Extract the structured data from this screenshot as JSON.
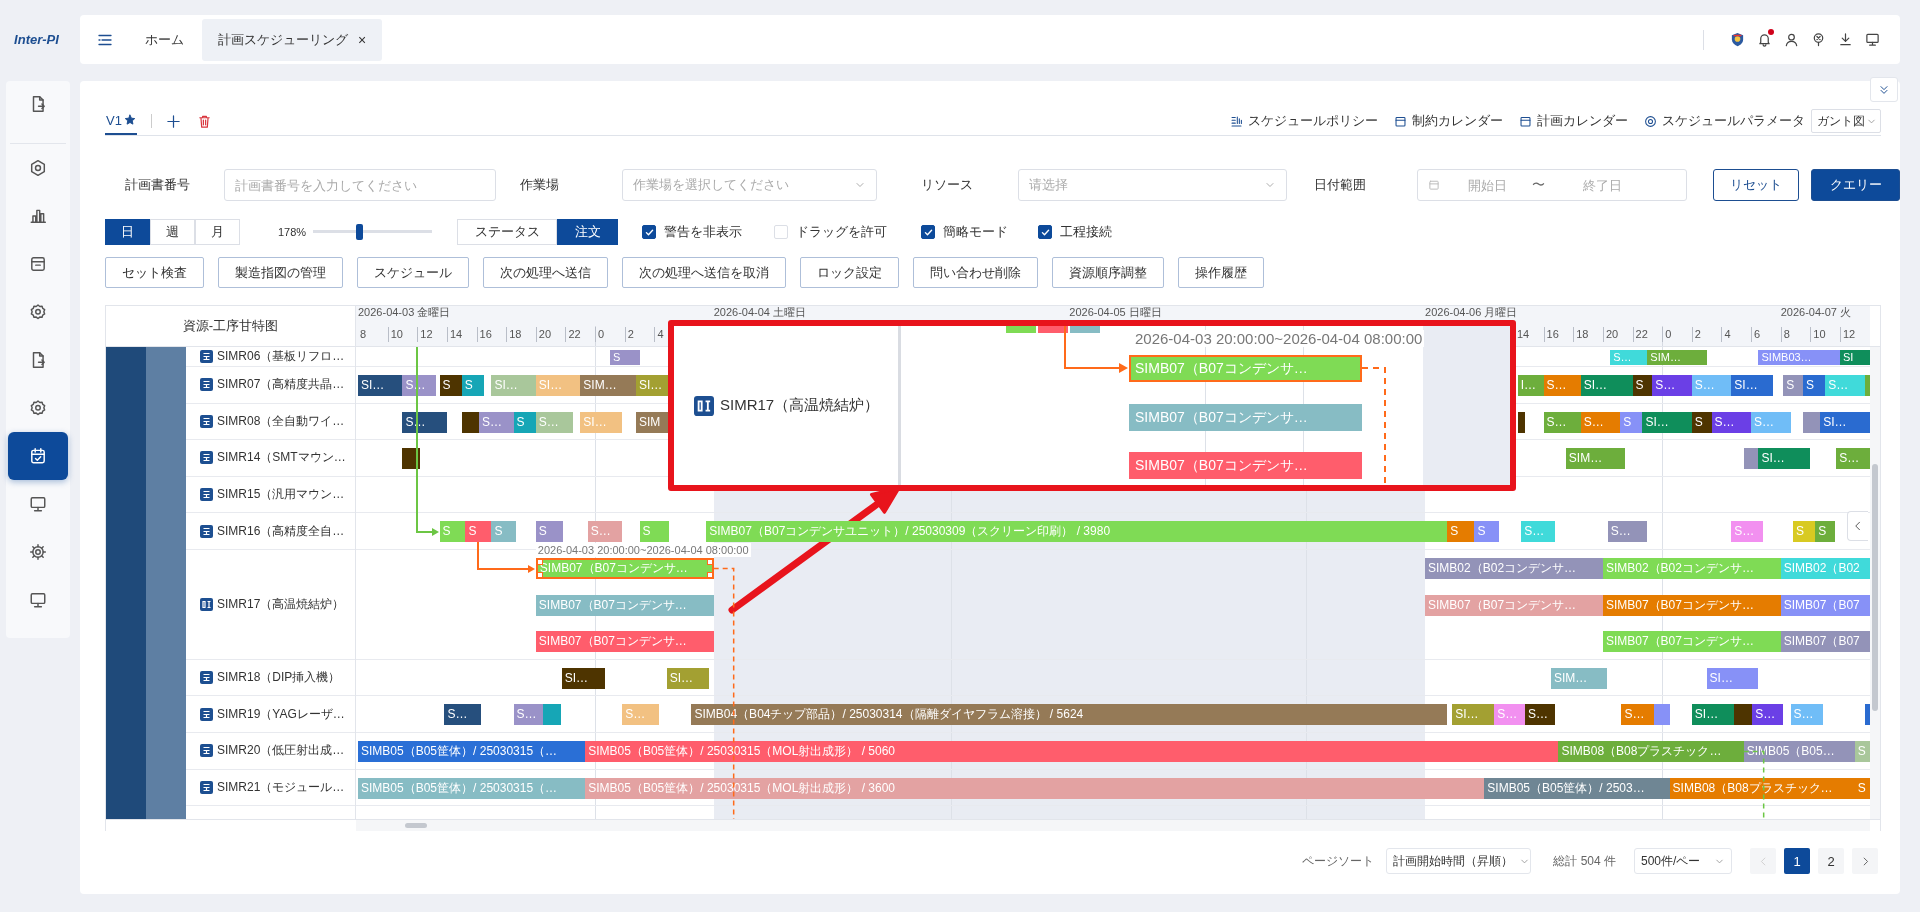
{
  "app": {
    "logo": "Inter-PI"
  },
  "sidebar": {
    "items": [
      {
        "selected": false
      },
      {
        "selected": false
      },
      {
        "selected": false
      },
      {
        "selected": false
      },
      {
        "selected": false
      },
      {
        "selected": false
      },
      {
        "selected": false
      },
      {
        "selected": true
      },
      {
        "selected": false
      },
      {
        "selected": false
      },
      {
        "selected": false
      }
    ]
  },
  "topbar": {
    "tabs": [
      {
        "label": "ホーム",
        "selected": false,
        "closable": false
      },
      {
        "label": "計画スケジューリング",
        "selected": true,
        "closable": true
      }
    ],
    "close_glyph": "×",
    "icons": [
      {
        "badge": false
      },
      {
        "badge": true
      },
      {
        "badge": false
      },
      {
        "badge": false
      },
      {
        "badge": false
      },
      {
        "badge": false
      }
    ]
  },
  "versions": {
    "tabs": [
      {
        "label": "V1",
        "selected": true,
        "starred": true
      }
    ],
    "links": [
      "スケジュールポリシー",
      "制約カレンダー",
      "計画カレンダー",
      "スケジュールパラメータ"
    ],
    "view_select": "ガント図"
  },
  "filters": {
    "fields": [
      {
        "kind": "text",
        "label": "計画書番号",
        "placeholder": "計画書番号を入力してください"
      },
      {
        "kind": "select",
        "label": "作業場",
        "placeholder": "作業場を選択してください"
      },
      {
        "kind": "select",
        "label": "リソース",
        "placeholder": "请选择"
      },
      {
        "kind": "daterange",
        "label": "日付範囲",
        "placeholder": "開始日",
        "placeholder_end": "終了日",
        "separator": "〜"
      }
    ],
    "buttons": [
      {
        "kind": "secondary",
        "label": "リセット"
      },
      {
        "kind": "primary",
        "label": "クエリー"
      }
    ]
  },
  "toolbar": {
    "scale": [
      {
        "label": "日",
        "selected": true
      },
      {
        "label": "週",
        "selected": false
      },
      {
        "label": "月",
        "selected": false
      }
    ],
    "zoom": {
      "reading": "178%",
      "level": 0.39
    },
    "mode": [
      {
        "label": "ステータス",
        "selected": false
      },
      {
        "label": "注文",
        "selected": true
      }
    ],
    "options": [
      {
        "label": "警告を非表示",
        "checked": true
      },
      {
        "label": "ドラッグを許可",
        "checked": false
      },
      {
        "label": "簡略モード",
        "checked": true
      },
      {
        "label": "工程接続",
        "checked": true
      }
    ]
  },
  "actions": [
    "セット検査",
    "製造指図の管理",
    "スケジュール",
    "次の処理へ送信",
    "次の処理へ送信を取消",
    "ロック設定",
    "問い合わせ削除",
    "資源順序調整",
    "操作履歴"
  ],
  "gantt": {
    "header": "資源-工序甘特图",
    "dates": [
      "2026-04-03 金曜日",
      "2026-04-04 土曜日",
      "2026-04-05 日曜日",
      "2026-04-06 月曜日",
      "2026-04-07 火"
    ],
    "hours": [
      "8",
      "10",
      "12",
      "14",
      "16",
      "18",
      "20",
      "22",
      "0",
      "2",
      "4",
      "14",
      "16",
      "18",
      "20",
      "22",
      "0",
      "2",
      "4",
      "6",
      "8",
      "10",
      "12"
    ],
    "rows": [
      {
        "name": "SIMR06（基板リフロ…",
        "bars": [
          {
            "label": "S",
            "color": "#9a92c8",
            "selected": false
          },
          {
            "label": "S…",
            "color": "#40dada",
            "selected": false
          },
          {
            "label": "SIM…",
            "color": "#6dae3c",
            "selected": false
          },
          {
            "label": "SIMB03…",
            "color": "#8791f7",
            "selected": false
          },
          {
            "label": "SI",
            "color": "#0f8e5b",
            "selected": false
          }
        ]
      },
      {
        "name": "SIMR07（高精度共晶…",
        "bars": [
          {
            "label": "SI…",
            "color": "#264f7d",
            "selected": false
          },
          {
            "label": "S…",
            "color": "#9a92c8",
            "selected": false
          },
          {
            "label": "S",
            "color": "#4e3400",
            "selected": false
          },
          {
            "label": "S",
            "color": "#16a6b6",
            "selected": false
          },
          {
            "label": "SI…",
            "color": "#a9c79b",
            "selected": false
          },
          {
            "label": "SI…",
            "color": "#f2c182",
            "selected": false
          },
          {
            "label": "SIM…",
            "color": "#957a57",
            "selected": false
          },
          {
            "label": "SI…",
            "color": "#a3a032",
            "selected": false
          },
          {
            "label": "I…",
            "color": "#6dae3c",
            "selected": false
          },
          {
            "label": "S…",
            "color": "#e57c00",
            "selected": false
          },
          {
            "label": "SI…",
            "color": "#0f8e5b",
            "selected": false
          },
          {
            "label": "S",
            "color": "#4e3400",
            "selected": false
          },
          {
            "label": "S…",
            "color": "#6b3fe6",
            "selected": false
          },
          {
            "label": "S…",
            "color": "#70bdf7",
            "selected": false
          },
          {
            "label": "SI…",
            "color": "#2a6bd0",
            "selected": false
          },
          {
            "label": "S",
            "color": "#9393b8",
            "selected": false
          },
          {
            "label": "S",
            "color": "#2a6bd0",
            "selected": false
          },
          {
            "label": "S…",
            "color": "#40dada",
            "selected": false
          },
          {
            "color": "#6dae3c",
            "selected": false
          }
        ]
      },
      {
        "name": "SIMR08（全自動ワイ…",
        "bars": [
          {
            "label": "S…",
            "color": "#264f7d",
            "selected": false
          },
          {
            "color": "#4e3400",
            "selected": false
          },
          {
            "label": "S…",
            "color": "#9a92c8",
            "selected": false
          },
          {
            "label": "S",
            "color": "#16a6b6",
            "selected": false
          },
          {
            "label": "S…",
            "color": "#a9c79b",
            "selected": false
          },
          {
            "label": "SI…",
            "color": "#f2c182",
            "selected": false
          },
          {
            "label": "SIM",
            "color": "#957a57",
            "selected": false
          },
          {
            "color": "#4e3400",
            "selected": false
          },
          {
            "label": "S…",
            "color": "#6dae3c",
            "selected": false
          },
          {
            "label": "S…",
            "color": "#e57c00",
            "selected": false
          },
          {
            "label": "S",
            "color": "#8791f7",
            "selected": false
          },
          {
            "label": "SI…",
            "color": "#0f8e5b",
            "selected": false
          },
          {
            "label": "S",
            "color": "#4e3400",
            "selected": false
          },
          {
            "label": "S…",
            "color": "#6b3fe6",
            "selected": false
          },
          {
            "label": "S…",
            "color": "#70bdf7",
            "selected": false
          },
          {
            "color": "#9393b8",
            "selected": false
          },
          {
            "label": "SI…",
            "color": "#2a6bd0",
            "selected": false
          }
        ]
      },
      {
        "name": "SIMR14（SMTマウン…",
        "bars": [
          {
            "color": "#4e3400",
            "selected": false
          },
          {
            "label": "SIM…",
            "color": "#6dae3c",
            "selected": false
          },
          {
            "color": "#9393b8",
            "selected": false
          },
          {
            "label": "SI…",
            "color": "#0f8e5b",
            "selected": false
          },
          {
            "label": "S…",
            "color": "#6dae3c",
            "selected": false
          }
        ]
      },
      {
        "name": "SIMR15（汎用マウン…"
      },
      {
        "name": "SIMR16（高精度全自…",
        "bars": [
          {
            "label": "S",
            "color": "#7fdb55",
            "selected": false
          },
          {
            "label": "S",
            "color": "#ff5d6c",
            "selected": false
          },
          {
            "label": "S",
            "color": "#87bcc4",
            "selected": false
          },
          {
            "label": "S",
            "color": "#9a92c8",
            "selected": false
          },
          {
            "label": "S…",
            "color": "#e3a2a2",
            "selected": false
          },
          {
            "label": "S",
            "color": "#7fdb55",
            "selected": false
          },
          {
            "label": "SIMB07（B07コンデンサユニット）/ 25030309（スクリーン印刷） / 3980",
            "color": "#7fdb55",
            "selected": false
          },
          {
            "label": "S",
            "color": "#e57c00",
            "selected": false
          },
          {
            "label": "S",
            "color": "#8791f7",
            "selected": false
          },
          {
            "label": "S…",
            "color": "#40dada",
            "selected": false
          },
          {
            "label": "S…",
            "color": "#9393b8",
            "selected": false
          },
          {
            "label": "S…",
            "color": "#f290f0",
            "selected": false
          },
          {
            "label": "S",
            "color": "#d8ca22",
            "selected": false
          },
          {
            "label": "S",
            "color": "#6dae3c",
            "selected": false
          }
        ]
      },
      {
        "name": "SIMR17（高温焼結炉）",
        "bars": [
          {
            "label": "SIMB07（B07コンデンサ…",
            "color": "#7fdb55",
            "selected": true,
            "caption": "2026-04-03 20:00:00~2026-04-04 08:00:00"
          },
          {
            "label": "SIMB02（B02コンデンサ…",
            "color": "#9393b8",
            "selected": false
          },
          {
            "label": "SIMB02（B02コンデンサ…",
            "color": "#7fdb55",
            "selected": false
          },
          {
            "label": "SIMB02（B02",
            "color": "#40dada",
            "selected": false
          },
          {
            "label": "SIMB07（B07コンデンサ…",
            "color": "#87bcc4",
            "selected": false
          },
          {
            "label": "SIMB07（B07コンデンサ…",
            "color": "#e3a2a2",
            "selected": false
          },
          {
            "label": "SIMB07（B07コンデンサ…",
            "color": "#e57c00",
            "selected": false
          },
          {
            "label": "SIMB07（B07",
            "color": "#8791f7",
            "selected": false
          },
          {
            "label": "SIMB07（B07コンデンサ…",
            "color": "#ff5d6c",
            "selected": false
          },
          {
            "label": "SIMB07（B07コンデンサ…",
            "color": "#7fdb55",
            "selected": false
          },
          {
            "label": "SIMB07（B07",
            "color": "#9393b8",
            "selected": false
          }
        ]
      },
      {
        "name": "SIMR18（DIP挿入機）",
        "bars": [
          {
            "label": "SI…",
            "color": "#4e3400",
            "selected": false
          },
          {
            "label": "SI…",
            "color": "#a3a032",
            "selected": false
          },
          {
            "label": "SIM…",
            "color": "#87bcc4",
            "selected": false
          },
          {
            "label": "SI…",
            "color": "#8791f7",
            "selected": false
          }
        ]
      },
      {
        "name": "SIMR19（YAGレーザ…",
        "bars": [
          {
            "label": "S…",
            "color": "#264f7d",
            "selected": false
          },
          {
            "label": "S…",
            "color": "#9a92c8",
            "selected": false
          },
          {
            "color": "#16a6b6",
            "selected": false
          },
          {
            "label": "S…",
            "color": "#f2c182",
            "selected": false
          },
          {
            "label": "SIMB04（B04チップ部品）/ 25030314（隔離ダイヤフラム溶接） / 5624",
            "color": "#957a57",
            "selected": false
          },
          {
            "label": "SI…",
            "color": "#a3a032",
            "selected": false
          },
          {
            "label": "S…",
            "color": "#f290f0",
            "selected": false
          },
          {
            "label": "S…",
            "color": "#4e3400",
            "selected": false
          },
          {
            "label": "S…",
            "color": "#e57c00",
            "selected": false
          },
          {
            "color": "#8791f7",
            "selected": false
          },
          {
            "label": "SI…",
            "color": "#0f8e5b",
            "selected": false
          },
          {
            "color": "#4e3400",
            "selected": false
          },
          {
            "label": "S…",
            "color": "#6b3fe6",
            "selected": false
          },
          {
            "label": "S…",
            "color": "#70bdf7",
            "selected": false
          },
          {
            "color": "#2a6bd0",
            "selected": false
          }
        ]
      },
      {
        "name": "SIMR20（低圧射出成…",
        "bars": [
          {
            "label": "SIMB05（B05筐体）/ 25030315（…",
            "color": "#2a6fd6",
            "selected": false
          },
          {
            "label": "SIMB05（B05筐体）/ 25030315（MOL射出成形） / 5060",
            "color": "#ff5d6c",
            "selected": false
          },
          {
            "label": "SIMB08（B08プラスチック…",
            "color": "#6dae3c",
            "selected": false
          },
          {
            "label": "SIMB05（B05…",
            "color": "#9393b8",
            "selected": false
          },
          {
            "label": "S",
            "color": "#a9c79b",
            "selected": false
          }
        ]
      },
      {
        "name": "SIMR21（モジュール…",
        "bars": [
          {
            "label": "SIMB05（B05筐体）/ 25030315（…",
            "color": "#87bcc4",
            "selected": false
          },
          {
            "label": "SIMB05（B05筐体）/ 25030315（MOL射出成形） / 3600",
            "color": "#e3a2a2",
            "selected": false
          },
          {
            "label": "SIMB05（B05筐体）/ 2503…",
            "color": "#6f8694",
            "selected": false
          },
          {
            "label": "SIMB08（B08プラスチック…",
            "color": "#e57c00",
            "selected": false
          },
          {
            "label": "S",
            "color": "#e57c00",
            "selected": false
          }
        ]
      }
    ],
    "links": [
      {
        "kind": "arrow",
        "color": "#6cc644"
      },
      {
        "kind": "arrow",
        "color": "#ff6a1a"
      },
      {
        "kind": "trail",
        "color": "#ff6a1a"
      },
      {
        "kind": "trail",
        "color": "#6cc644"
      }
    ],
    "callout": {
      "resource": "SIMR17（高温焼結炉）",
      "caption": "2026-04-03 20:00:00~2026-04-04 08:00:00",
      "peek_bars": [
        {
          "color": "#7fdb55"
        },
        {
          "color": "#ff5d6c"
        },
        {
          "color": "#87bcc4"
        }
      ],
      "bars": [
        {
          "label": "SIMB07（B07コンデンサ…",
          "color": "#7fdb55",
          "selected": true
        },
        {
          "label": "SIMB07（B07コンデンサ…",
          "color": "#87bcc4",
          "selected": false
        },
        {
          "label": "SIMB07（B07コンデンサ…",
          "color": "#ff5d6c",
          "selected": false
        }
      ]
    }
  },
  "pager": {
    "sort_label": "ページソート",
    "sort_value": "計画開始時間（昇順）",
    "total": "総計 504 件",
    "page_size": "500件/ペー",
    "prev_disabled": true,
    "next_disabled": false,
    "pages": [
      {
        "label": "1",
        "selected": true
      },
      {
        "label": "2",
        "selected": false
      }
    ]
  }
}
